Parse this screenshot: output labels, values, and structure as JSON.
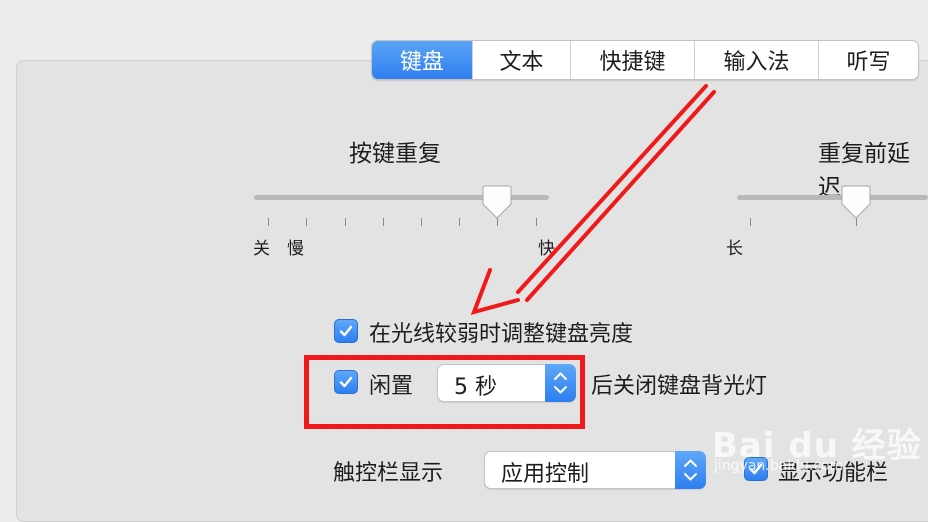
{
  "tabs": [
    "键盘",
    "文本",
    "快捷键",
    "输入法",
    "听写"
  ],
  "active_tab": "键盘",
  "key_repeat": {
    "title": "按键重复",
    "labels": {
      "off": "关",
      "slow": "慢",
      "fast": "快"
    }
  },
  "delay_until_repeat": {
    "title": "重复前延迟",
    "labels": {
      "long": "长"
    }
  },
  "adjust_brightness": {
    "label": "在光线较弱时调整键盘亮度",
    "checked": true
  },
  "idle_backlight": {
    "prefix": "闲置",
    "value": "5 秒",
    "suffix": "后关闭键盘背光灯",
    "checked": true
  },
  "touch_bar": {
    "label": "触控栏显示",
    "value": "应用控制",
    "show_function_label": "显示功能栏",
    "checked": true
  },
  "watermark": {
    "text": "Bai du 经验",
    "sub": "jingyan.baidu.com"
  },
  "colors": {
    "accent": "#2f7ef0",
    "highlight": "#f01919"
  }
}
